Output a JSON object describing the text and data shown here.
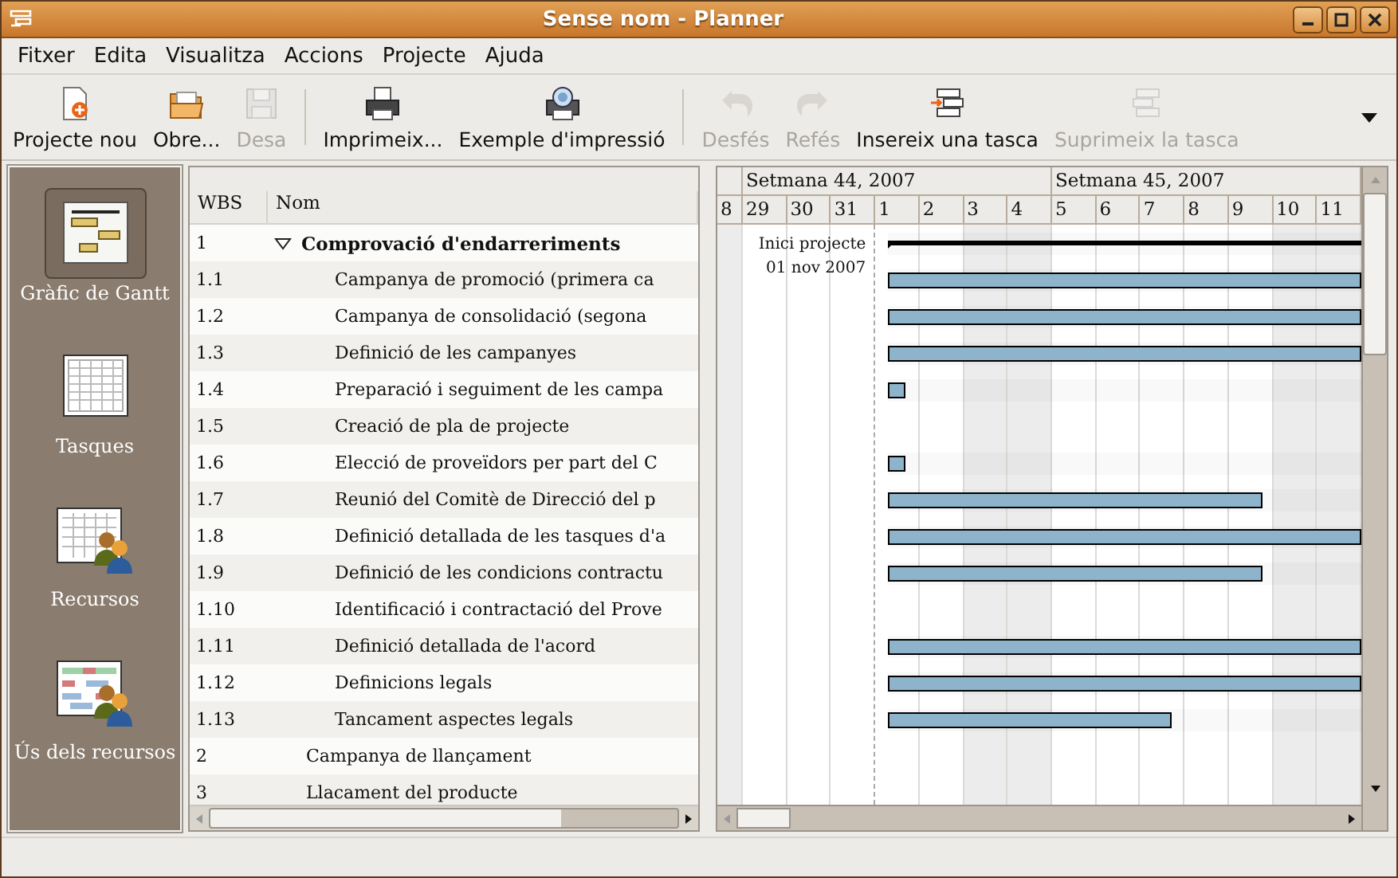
{
  "window": {
    "title": "Sense nom - Planner"
  },
  "menu": [
    {
      "label": "Fitxer"
    },
    {
      "label": "Edita"
    },
    {
      "label": "Visualitza"
    },
    {
      "label": "Accions"
    },
    {
      "label": "Projecte"
    },
    {
      "label": "Ajuda"
    }
  ],
  "toolbar": {
    "items": [
      {
        "kind": "new",
        "label": "Projecte nou",
        "disabled": false
      },
      {
        "kind": "open",
        "label": "Obre...",
        "disabled": false
      },
      {
        "kind": "save",
        "label": "Desa",
        "disabled": true
      },
      {
        "kind": "separator"
      },
      {
        "kind": "print",
        "label": "Imprimeix...",
        "disabled": false
      },
      {
        "kind": "preview",
        "label": "Exemple d'impressió",
        "disabled": false
      },
      {
        "kind": "separator"
      },
      {
        "kind": "undo",
        "label": "Desfés",
        "disabled": true
      },
      {
        "kind": "redo",
        "label": "Refés",
        "disabled": true
      },
      {
        "kind": "insert",
        "label": "Insereix una tasca",
        "disabled": false
      },
      {
        "kind": "delete",
        "label": "Suprimeix la tasca",
        "disabled": true
      }
    ]
  },
  "sidebar": {
    "items": [
      {
        "kind": "gantt",
        "label": "Gràfic de Gantt",
        "selected": true
      },
      {
        "kind": "tasks",
        "label": "Tasques",
        "selected": false
      },
      {
        "kind": "resources",
        "label": "Recursos",
        "selected": false
      },
      {
        "kind": "usage",
        "label": "Ús dels recursos",
        "selected": false
      }
    ]
  },
  "table": {
    "columns": [
      "WBS",
      "Nom"
    ],
    "rows": [
      {
        "wbs": "1",
        "name": "Comprovació d'endarreriments",
        "expanded": true,
        "bar": {
          "kind": "summary",
          "level": 1
        },
        "children": [
          {
            "wbs": "1.1",
            "name": "Campanya de promoció (primera ca",
            "bar": {
              "kind": "task",
              "level": 1
            }
          },
          {
            "wbs": "1.2",
            "name": "Campanya de consolidació (segona",
            "bar": {
              "kind": "task",
              "level": 1
            }
          },
          {
            "wbs": "1.3",
            "name": "Definició de les campanyes",
            "bar": {
              "kind": "task",
              "level": 1
            }
          },
          {
            "wbs": "1.4",
            "name": "Preparació i seguiment de les campa",
            "bar": {
              "kind": "task",
              "level": 0.035
            }
          },
          {
            "wbs": "1.5",
            "name": "Creació de pla de projecte"
          },
          {
            "wbs": "1.6",
            "name": "Elecció de proveïdors per part del C",
            "bar": {
              "kind": "task",
              "level": 0.035
            }
          },
          {
            "wbs": "1.7",
            "name": "Reunió del Comitè de Direcció del p",
            "bar": {
              "kind": "task",
              "level": 0.79
            }
          },
          {
            "wbs": "1.8",
            "name": "Definició detallada de les tasques d'a",
            "bar": {
              "kind": "task",
              "level": 1
            }
          },
          {
            "wbs": "1.9",
            "name": "Definició de les condicions contractu",
            "bar": {
              "kind": "task",
              "level": 0.79
            }
          },
          {
            "wbs": "1.10",
            "name": "Identificació i contractació del Prove"
          },
          {
            "wbs": "1.11",
            "name": "Definició detallada de l'acord",
            "bar": {
              "kind": "task",
              "level": 1
            }
          },
          {
            "wbs": "1.12",
            "name": "Definicions legals",
            "bar": {
              "kind": "task",
              "level": 1
            }
          },
          {
            "wbs": "1.13",
            "name": "Tancament aspectes legals",
            "bar": {
              "kind": "task",
              "level": 0.6
            }
          }
        ]
      },
      {
        "wbs": "2",
        "name": "Campanya de llançament"
      },
      {
        "wbs": "3",
        "name": "Llacament del producte"
      }
    ]
  },
  "gantt": {
    "weeks": [
      {
        "days": [
          {
            "label": "8",
            "weekend": true
          }
        ]
      },
      {
        "label": "Setmana 44, 2007",
        "days": [
          {
            "label": "29",
            "weekend": false
          },
          {
            "label": "30",
            "weekend": false
          },
          {
            "label": "31",
            "weekend": false
          },
          {
            "label": "1",
            "weekend": false
          },
          {
            "label": "2",
            "weekend": false
          },
          {
            "label": "3",
            "weekend": true
          },
          {
            "label": "4",
            "weekend": true
          }
        ]
      },
      {
        "label": "Setmana 45, 2007",
        "days": [
          {
            "label": "5",
            "weekend": false
          },
          {
            "label": "6",
            "weekend": false
          },
          {
            "label": "7",
            "weekend": false
          },
          {
            "label": "8",
            "weekend": false
          },
          {
            "label": "9",
            "weekend": false
          },
          {
            "label": "10",
            "weekend": true
          },
          {
            "label": "11",
            "weekend": true
          }
        ]
      }
    ],
    "project_start": {
      "label": "Inici projecte",
      "date": "01 nov 2007"
    }
  }
}
